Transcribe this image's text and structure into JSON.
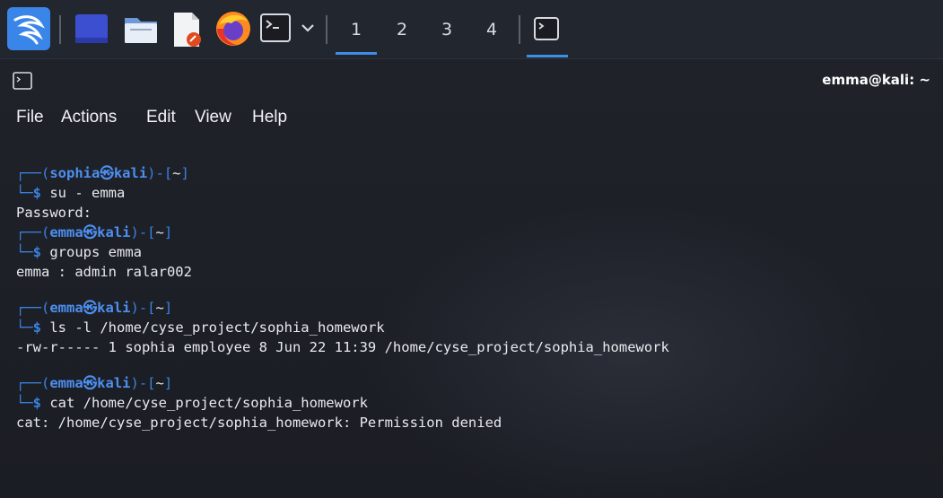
{
  "taskbar": {
    "workspaces": [
      "1",
      "2",
      "3",
      "4"
    ],
    "active_workspace": "1",
    "accent": "#3d8ee6"
  },
  "window": {
    "title": "emma@kali: ~"
  },
  "menu": [
    "File",
    "Actions",
    "Edit",
    "View",
    "Help"
  ],
  "terminal": {
    "blocks": [
      {
        "user": "sophia",
        "host": "kali",
        "dir": "~",
        "command": "su - emma"
      },
      {
        "output": "Password:"
      },
      {
        "user": "emma",
        "host": "kali",
        "dir": "~",
        "command": "groups emma"
      },
      {
        "output": "emma : admin ralar002"
      },
      {
        "user": "emma",
        "host": "kali",
        "dir": "~",
        "command": "ls -l /home/cyse_project/sophia_homework"
      },
      {
        "output": "-rw-r----- 1 sophia employee 8 Jun 22 11:39 /home/cyse_project/sophia_homework"
      },
      {
        "user": "emma",
        "host": "kali",
        "dir": "~",
        "command": "cat /home/cyse_project/sophia_homework"
      },
      {
        "output": "cat: /home/cyse_project/sophia_homework: Permission denied"
      }
    ]
  },
  "colors": {
    "prompt": "#4d8ff0",
    "background": "#1b1e27"
  }
}
